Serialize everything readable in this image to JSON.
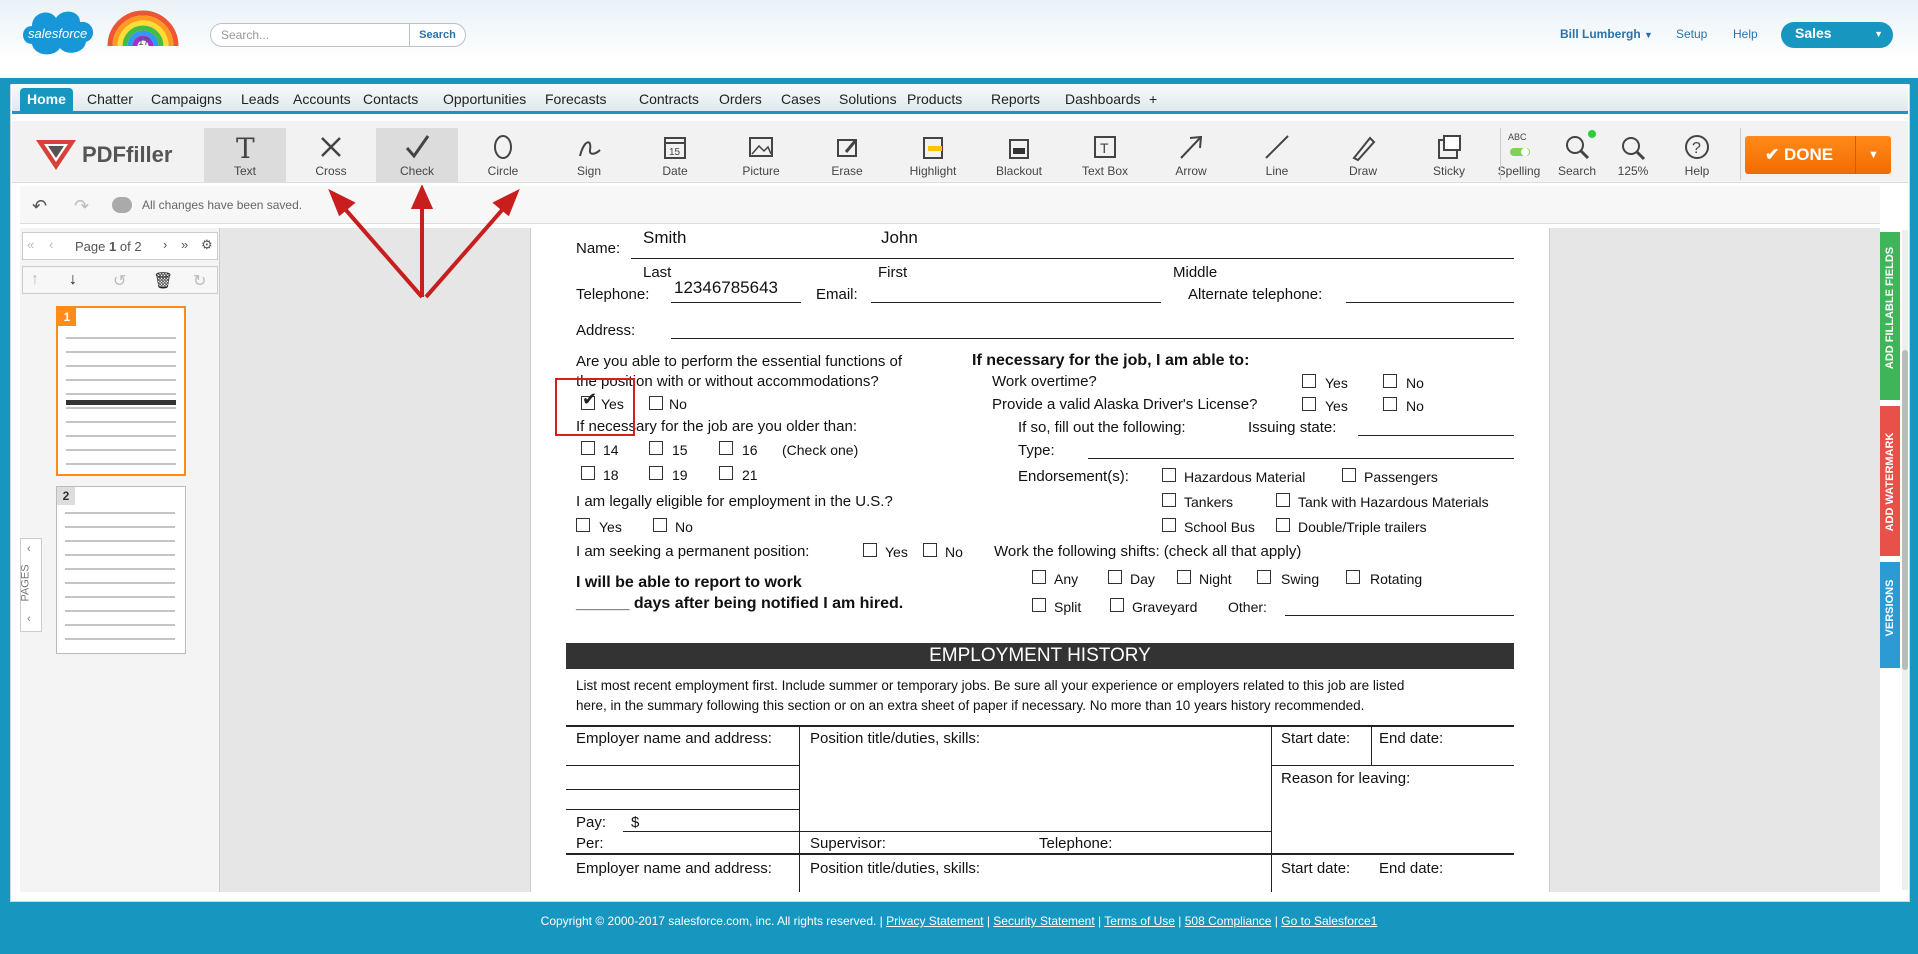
{
  "header": {
    "logo_text": "salesforce",
    "badge": "17",
    "search_placeholder": "Search...",
    "search_button": "Search",
    "user": "Bill Lumbergh",
    "setup": "Setup",
    "help": "Help",
    "app": "Sales"
  },
  "tabs": [
    "Home",
    "Chatter",
    "Campaigns",
    "Leads",
    "Accounts",
    "Contacts",
    "Opportunities",
    "Forecasts",
    "Contracts",
    "Orders",
    "Cases",
    "Solutions",
    "Products",
    "Reports",
    "Dashboards",
    "+"
  ],
  "toolbar": {
    "logo": "PDFfiller",
    "tools": [
      "Text",
      "Cross",
      "Check",
      "Circle",
      "Sign",
      "Date",
      "Picture",
      "Erase",
      "Highlight",
      "Blackout",
      "Text Box",
      "Arrow",
      "Line",
      "Draw",
      "Sticky"
    ],
    "right_tools": [
      "Spelling",
      "Search",
      "125%",
      "Help"
    ],
    "spelling_badge": "ABC",
    "date_icon_day": "15",
    "done": "DONE"
  },
  "status": {
    "saved": "All changes have been saved."
  },
  "pager": {
    "prefix": "Page",
    "current": "1",
    "suffix": "of 2"
  },
  "pages_label": "PAGES",
  "thumbnails": [
    "1",
    "2"
  ],
  "form": {
    "name_label": "Name:",
    "last_value": "Smith",
    "first_value": "John",
    "last": "Last",
    "first": "First",
    "middle": "Middle",
    "telephone_label": "Telephone:",
    "telephone_value": "12346785643",
    "email_label": "Email:",
    "alt_tel_label": "Alternate telephone:",
    "address_label": "Address:",
    "q_functions_1": "Are you able to perform the essential functions of",
    "q_functions_2": "the position with or without accommodations?",
    "yes": "Yes",
    "no": "No",
    "q_older": "If necessary for the job are you older than:",
    "ages": [
      "14",
      "15",
      "16",
      "18",
      "19",
      "21"
    ],
    "check_one": "(Check one)",
    "q_eligible": "I am legally eligible for employment in the U.S.?",
    "q_permanent": "I am seeking a permanent position:",
    "report_1": "I will be able to report to work",
    "report_2": "______  days after being notified I am hired.",
    "able_title": "If necessary for the job, I am able to:",
    "overtime": "Work overtime?",
    "license": "Provide a valid Alaska Driver's License?",
    "fill_following": "If so, fill out the following:",
    "issuing_state": "Issuing state:",
    "type": "Type:",
    "endorsements": "Endorsement(s):",
    "endorse_items": [
      "Hazardous Material",
      "Passengers",
      "Tankers",
      "Tank with Hazardous Materials",
      "School Bus",
      "Double/Triple trailers"
    ],
    "shifts_label": "Work the following shifts: (check all that apply)",
    "shifts": [
      "Any",
      "Day",
      "Night",
      "Swing",
      "Rotating",
      "Split",
      "Graveyard"
    ],
    "other": "Other:"
  },
  "history": {
    "title": "EMPLOYMENT HISTORY",
    "intro_1": "List most recent employment first. Include summer or temporary jobs. Be sure all your experience or employers related to this job are listed",
    "intro_2": "here, in the summary following this section or on an extra sheet of paper if necessary. No more than 10 years history recommended.",
    "employer": "Employer name and address:",
    "position": "Position title/duties, skills:",
    "start": "Start date:",
    "end": "End date:",
    "reason": "Reason for leaving:",
    "pay": "Pay:",
    "dollar": "$",
    "per": "Per:",
    "supervisor": "Supervisor:",
    "telephone": "Telephone:"
  },
  "side_tabs": [
    "ADD FILLABLE FIELDS",
    "ADD WATERMARK",
    "VERSIONS"
  ],
  "footer": {
    "copyright": "Copyright © 2000-2017 salesforce.com, inc. All rights reserved. |",
    "links": [
      "Privacy Statement",
      "Security Statement",
      "Terms of Use",
      "508 Compliance",
      "Go to Salesforce1"
    ]
  },
  "colors": {
    "accent": "#1797c0",
    "done": "#f36b00",
    "annotation": "#d12020",
    "fillable": "#3fb55a",
    "watermark": "#e8504a",
    "versions": "#2c9bd4"
  }
}
